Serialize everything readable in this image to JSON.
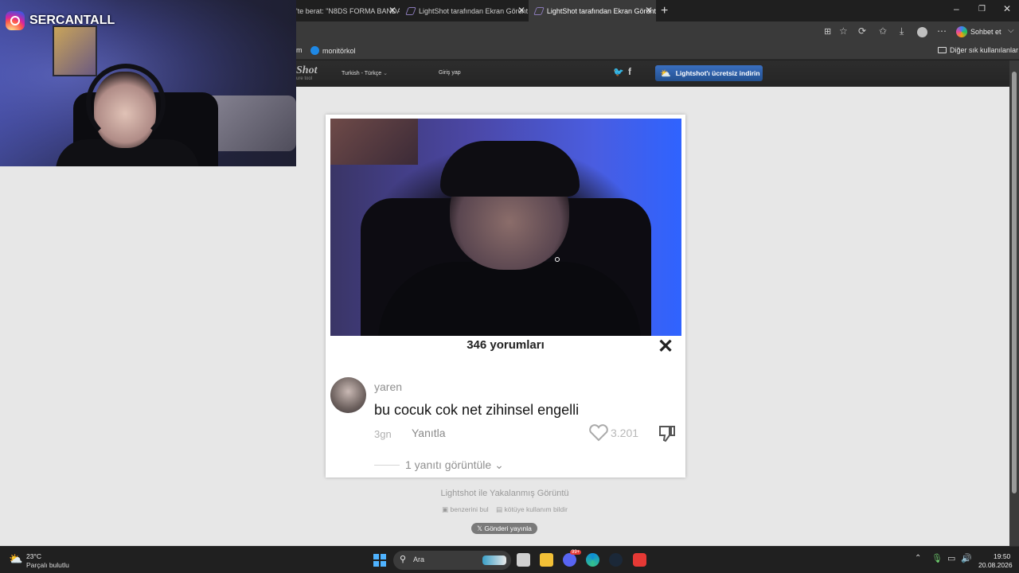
{
  "browser": {
    "tabs": [
      {
        "label": "'te berat: \"N8DS FORMA BANDA"
      },
      {
        "label": "LightShot tarafından Ekran Görünt"
      },
      {
        "label": "LightShot tarafından Ekran Görünt"
      }
    ],
    "new_tab": "+",
    "window_controls": [
      "–",
      "❐",
      "✕"
    ],
    "toolbar": {
      "chat_label": "Sohbet et"
    },
    "bookmarks": {
      "partial_item": "m",
      "item": "monitörkol",
      "other": "Diğer sık kullanılanlar"
    }
  },
  "lightshot": {
    "logo": "Shot",
    "logo_sub": "ure tool",
    "language": "Turkish - Türkçe",
    "login": "Giriş yap",
    "download": "Lightshot'ı ücretsiz indirin",
    "caption": "Lightshot ile Yakalanmış Görüntü",
    "find_similar": "benzerini bul",
    "report": "kötüye kullanım bildir",
    "post_button": "𝕏 Gönderi yayınla"
  },
  "screenshot_content": {
    "comments_count": "346 yorumları",
    "close": "✕",
    "username": "yaren",
    "comment": "bu cocuk cok net zihinsel engelli",
    "age": "3gn",
    "reply": "Yanıtla",
    "likes": "3.201",
    "view_replies": "1 yanıtı görüntüle"
  },
  "stream_overlay": {
    "instagram_handle": "SERCANTALL"
  },
  "taskbar": {
    "weather_temp": "23°C",
    "weather_desc": "Parçalı bulutlu",
    "search_label": "Ara",
    "time": "19:50",
    "date": "20.08.2026",
    "discord_badge": "99+"
  },
  "colors": {
    "accent_button": "#2b5ea8",
    "page_bg": "#e7e7e7"
  }
}
